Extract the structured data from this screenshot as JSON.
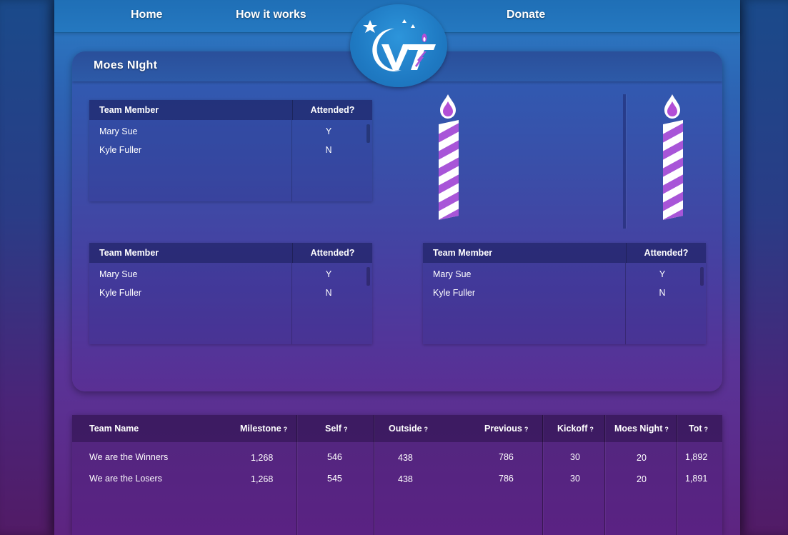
{
  "nav": {
    "home": "Home",
    "how_it_works": "How it works",
    "donate": "Donate"
  },
  "panel": {
    "title": "Moes NIght"
  },
  "attendance_tables": [
    {
      "headers": [
        "Team Member",
        "Attended?"
      ],
      "rows": [
        {
          "member": "Mary Sue",
          "attended": "Y"
        },
        {
          "member": "Kyle Fuller",
          "attended": "N"
        }
      ]
    },
    {
      "headers": [
        "Team Member",
        "Attended?"
      ],
      "rows": [
        {
          "member": "Mary Sue",
          "attended": "Y"
        },
        {
          "member": "Kyle Fuller",
          "attended": "N"
        }
      ]
    },
    {
      "headers": [
        "Team Member",
        "Attended?"
      ],
      "rows": [
        {
          "member": "Mary Sue",
          "attended": "Y"
        },
        {
          "member": "Kyle Fuller",
          "attended": "N"
        }
      ]
    }
  ],
  "totals": {
    "headers": {
      "team_name": "Team Name",
      "milestone": "Milestone",
      "self": "Self",
      "outside": "Outside",
      "previous": "Previous",
      "kickoff": "Kickoff",
      "moes_night": "Moes Night",
      "tot": "Tot",
      "help_marker": "?"
    },
    "rows": [
      {
        "team": "We are the Winners",
        "milestone": "1,268",
        "self": "546",
        "outside": "438",
        "previous": "786",
        "kickoff": "30",
        "moes_night": "20",
        "tot": "1,892"
      },
      {
        "team": "We are the Losers",
        "milestone": "1,268",
        "self": "545",
        "outside": "438",
        "previous": "786",
        "kickoff": "30",
        "moes_night": "20",
        "tot": "1,891"
      }
    ]
  },
  "colors": {
    "candle_stripe": "#a855d8",
    "flame": "#b24fd6"
  }
}
